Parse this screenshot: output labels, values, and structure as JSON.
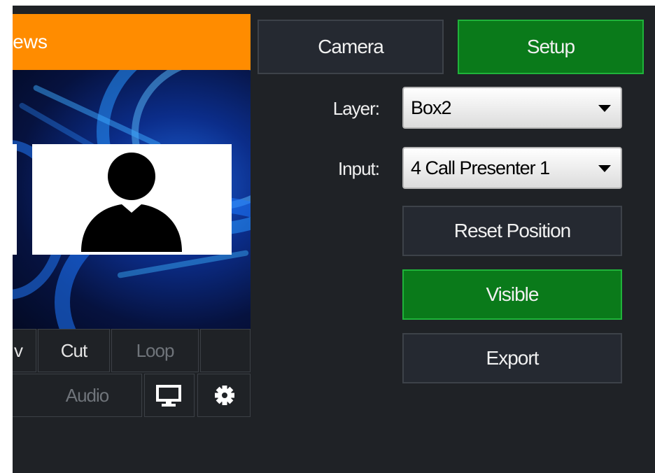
{
  "preview": {
    "title": "News"
  },
  "controls": {
    "cut_label": "Cut",
    "loop_label": "Loop",
    "audio_label": "Audio",
    "partial_label": "v",
    "monitor_icon": "monitor-icon",
    "settings_icon": "gear-icon"
  },
  "tabs": {
    "camera_label": "Camera",
    "setup_label": "Setup"
  },
  "layer": {
    "label": "Layer:",
    "value": "Box2"
  },
  "input": {
    "label": "Input:",
    "value": "4 Call Presenter 1"
  },
  "buttons": {
    "reset_position": "Reset Position",
    "visible": "Visible",
    "export": "Export"
  },
  "colors": {
    "title_bar": "#ff8c00",
    "active_green": "#0a7a1a",
    "panel_bg": "#1f2226"
  }
}
